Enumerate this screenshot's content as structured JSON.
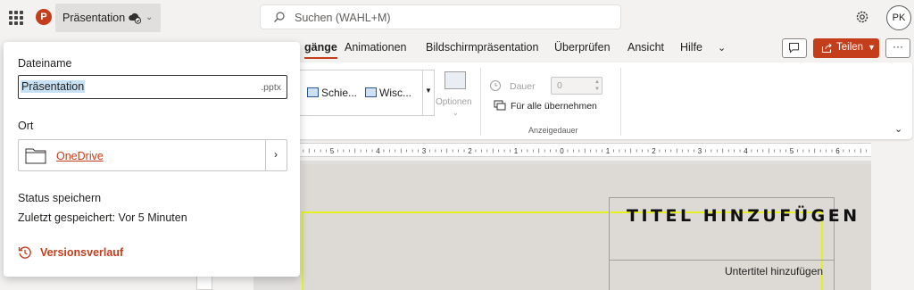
{
  "titlebar": {
    "app_icon_letter": "P",
    "doc_title": "Präsentation",
    "search_placeholder": "Suchen (WAHL+M)",
    "avatar_initials": "PK"
  },
  "ribbon_tabs": [
    {
      "label": "gänge",
      "active": true
    },
    {
      "label": "Animationen",
      "active": false
    },
    {
      "label": "Bildschirmpräsentation",
      "active": false
    },
    {
      "label": "Überprüfen",
      "active": false
    },
    {
      "label": "Ansicht",
      "active": false
    },
    {
      "label": "Hilfe",
      "active": false
    }
  ],
  "share": {
    "label": "Teilen"
  },
  "more": {
    "label": "···"
  },
  "ribbon": {
    "transitions": [
      "Schie...",
      "Wisc..."
    ],
    "options_label": "Optionen",
    "duration_label": "Dauer",
    "duration_value": "0",
    "apply_all_label": "Für alle übernehmen",
    "group_label": "Anzeigedauer"
  },
  "ruler": {
    "labels": [
      "5",
      "4",
      "3",
      "2",
      "1",
      "0",
      "1",
      "2",
      "3",
      "4",
      "5",
      "6"
    ]
  },
  "slide": {
    "title": "TITEL HINZUFÜGEN",
    "subtitle": "Untertitel hinzufügen"
  },
  "file_panel": {
    "filename_label": "Dateiname",
    "filename_value": "Präsentation",
    "filename_ext": ".pptx",
    "location_label": "Ort",
    "location_value": "OneDrive",
    "save_status_label": "Status speichern",
    "save_status_value": "Zuletzt gespeichert: Vor 5 Minuten",
    "version_history_label": "Versionsverlauf"
  },
  "colors": {
    "accent": "#c43e1c",
    "selection": "#c7e0f4",
    "frame_highlight": "#e5f01f"
  },
  "icons": [
    "app-launcher-icon",
    "powerpoint-icon",
    "saved-to-cloud-icon",
    "search-icon",
    "settings-gear-icon",
    "comment-icon",
    "share-icon",
    "clock-icon",
    "apply-all-icon",
    "folder-icon",
    "history-icon"
  ]
}
